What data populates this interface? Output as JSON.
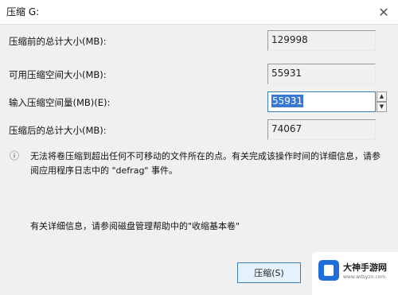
{
  "window": {
    "title": "压缩 G:",
    "close_glyph": "✕"
  },
  "fields": {
    "total_before": {
      "label": "压缩前的总计大小(MB):",
      "value": "129998"
    },
    "available": {
      "label": "可用压缩空间大小(MB):",
      "value": "55931"
    },
    "input": {
      "label": "输入压缩空间量(MB)(E):",
      "value": "55931"
    },
    "total_after": {
      "label": "压缩后的总计大小(MB):",
      "value": "74067"
    }
  },
  "info": {
    "icon": "info-icon",
    "text": "无法将卷压缩到超出任何不可移动的文件所在的点。有关完成该操作时间的详细信息，请参阅应用程序日志中的 \"defrag\" 事件。"
  },
  "help": {
    "text": "有关详细信息，请参阅磁盘管理帮助中的\"收缩基本卷\""
  },
  "buttons": {
    "shrink": "压缩(S)"
  },
  "watermark": {
    "name": "大神手游网",
    "url": "www.wdsyzn.com"
  },
  "colors": {
    "selection": "#3a78d4",
    "brand": "#1e6fd9"
  }
}
